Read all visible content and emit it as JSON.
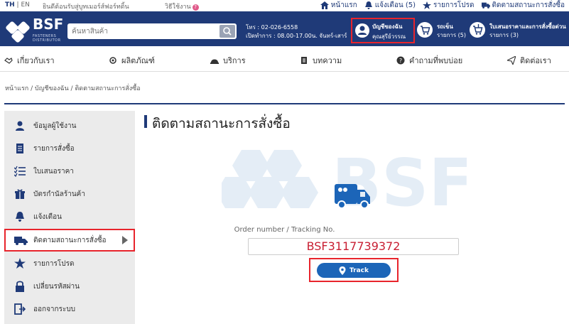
{
  "topbar": {
    "lang_th": "TH",
    "lang_sep": "|",
    "lang_en": "EN",
    "welcome": "ยินดีต้อนรับสู่บูทเมอร์ส์ฟอร์ทติ้น",
    "howto": "วิธีใช้งาน",
    "links": [
      {
        "label": "หน้าแรก",
        "icon": "home-icon"
      },
      {
        "label": "แจ้งเตือน (5)",
        "icon": "bell-icon"
      },
      {
        "label": "รายการโปรด",
        "icon": "star-icon"
      },
      {
        "label": "ติดตามสถานะการสั่งซื้อ",
        "icon": "truck-icon"
      }
    ]
  },
  "header": {
    "logo_text": "BSF",
    "logo_sub": "FASTENERS DISTRIBUTOR",
    "search_placeholder": "ค้นหาสินค้า",
    "phone": "โทร : 02-026-6558",
    "hours": "เปิดทำการ : 08.00-17.00น. จันทร์-เสาร์",
    "account_title": "บัญชีของฉัน",
    "account_name": "คุณสุรีย์วรรณ",
    "cart_title": "รถเข็น",
    "cart_count": "รายการ (5)",
    "quote_title": "ใบเสนอราคาและการสั่งซื้อด่วน",
    "quote_count": "รายการ (3)"
  },
  "nav": {
    "items": [
      {
        "label": "เกี่ยวกับเรา",
        "icon": "handshake-icon"
      },
      {
        "label": "ผลิตภัณฑ์",
        "icon": "bolt-icon"
      },
      {
        "label": "บริการ",
        "icon": "helmet-icon"
      },
      {
        "label": "บทความ",
        "icon": "document-icon"
      },
      {
        "label": "คำถามที่พบบ่อย",
        "icon": "question-icon"
      },
      {
        "label": "ติดต่อเรา",
        "icon": "send-icon"
      }
    ]
  },
  "breadcrumb": "หน้าแรก / บัญชีของฉัน / ติดตามสถานะการสั่งซื้อ",
  "sidebar": {
    "items": [
      {
        "label": "ข้อมูลผู้ใช้งาน",
        "icon": "user-icon"
      },
      {
        "label": "รายการสั่งซื้อ",
        "icon": "list-icon"
      },
      {
        "label": "ใบเสนอราคา",
        "icon": "checklist-icon"
      },
      {
        "label": "บัตรกำนัลร้านค้า",
        "icon": "gift-icon"
      },
      {
        "label": "แจ้งเตือน",
        "icon": "bell-icon"
      },
      {
        "label": "ติดตามสถานะการสั่งซื้อ",
        "icon": "truck-icon"
      },
      {
        "label": "รายการโปรด",
        "icon": "star-icon"
      },
      {
        "label": "เปลี่ยนรหัสผ่าน",
        "icon": "lock-icon"
      },
      {
        "label": "ออกจากระบบ",
        "icon": "logout-icon"
      }
    ],
    "active_index": 5
  },
  "main": {
    "title": "ติดตามสถานะการสั่งซื้อ",
    "watermark_text": "BSF",
    "order_label": "Order number / Tracking No.",
    "order_value": "BSF3117739372",
    "track_button": "Track"
  },
  "colors": {
    "brand": "#1f3a78",
    "accent_red": "#e8242c",
    "button_blue": "#1c65b8",
    "order_text": "#c81e32"
  }
}
